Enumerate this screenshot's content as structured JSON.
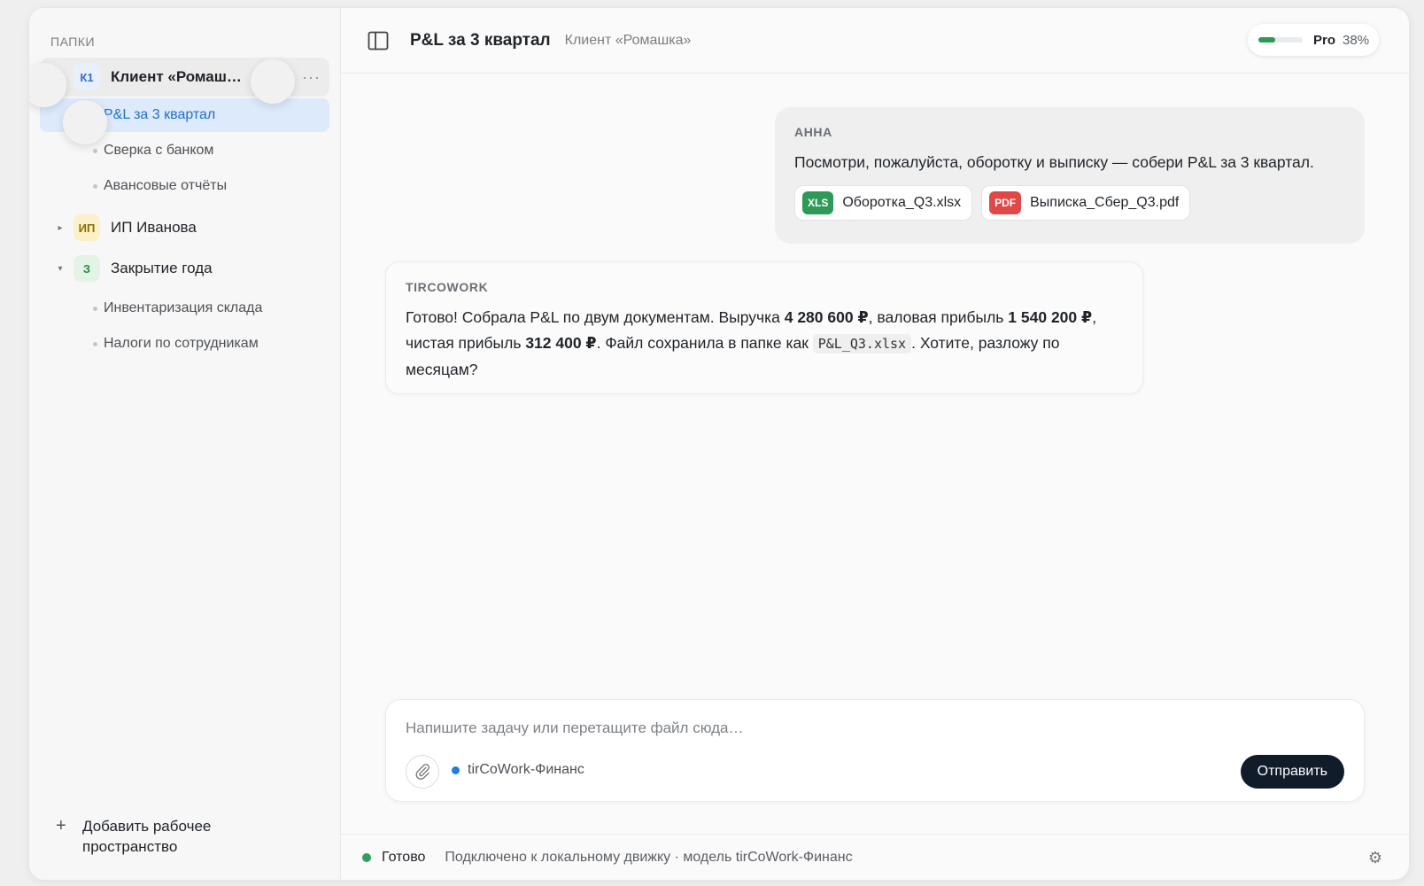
{
  "sidebar": {
    "title": "ПАПКИ",
    "folders": [
      {
        "badge": "К1",
        "label": "Клиент «Ромаш…",
        "more": "···",
        "items": [
          "P&L за 3 квартал",
          "Сверка с банком",
          "Авансовые отчёты"
        ]
      },
      {
        "caret": "▸",
        "badge": "ИП",
        "label": "ИП Иванова"
      },
      {
        "caret": "▾",
        "badge": "З",
        "label": "Закрытие года",
        "items": [
          "Инвентаризация склада",
          "Налоги по сотрудникам"
        ]
      }
    ],
    "add_workspace": "Добавить рабочее пространство"
  },
  "header": {
    "title": "P&L за 3 квартал",
    "subtitle": "Клиент «Ромашка»",
    "plan": "Pro",
    "usage": "38%",
    "usage_fraction": 0.38
  },
  "user_message": {
    "author": "АННА",
    "text": "Посмотри, пожалуйста, оборотку и выписку — собери P&L за 3 квартал.",
    "files": [
      {
        "type": "XLS",
        "name": "Оборотка_Q3.xlsx",
        "color": "#2f9a57"
      },
      {
        "type": "PDF",
        "name": "Выписка_Сбер_Q3.pdf",
        "color": "#e04848"
      }
    ]
  },
  "ai_message": {
    "author": "TIRCOWORK",
    "part1": "Готово! Собрала P&L по двум документам. Выручка ",
    "revenue": "4 280 600 ₽",
    "part2": ", валовая прибыль ",
    "gross_profit": "1 540 200 ₽",
    "part3": ", чистая прибыль ",
    "net_profit": "312 400 ₽",
    "part4": ". Файл сохранила в папке как ",
    "file": "P&L_Q3.xlsx",
    "part5": ". Хотите, разложу по месяцам?"
  },
  "composer": {
    "placeholder": "Напишите задачу или перетащите файл сюда…",
    "model": "tirCoWork-Финанс",
    "send": "Отправить"
  },
  "status": {
    "state": "Готово",
    "info": "Подключено к локальному движку · модель tirCoWork-Финанс"
  },
  "colors": {
    "accent": "#1f6fd1",
    "status_ok": "#2ba15a",
    "send_bg": "#111c2b"
  }
}
